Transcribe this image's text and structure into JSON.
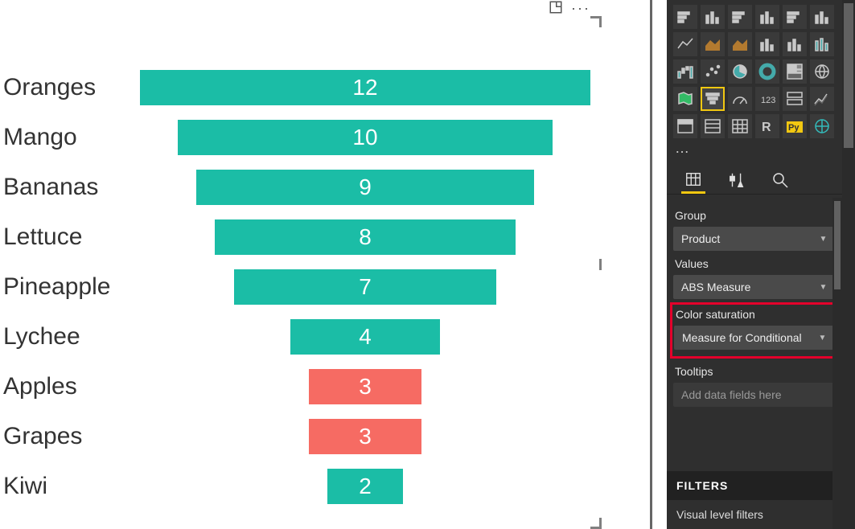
{
  "chart_data": {
    "type": "bar",
    "orientation": "funnel",
    "categories": [
      "Oranges",
      "Mango",
      "Bananas",
      "Lettuce",
      "Pineapple",
      "Lychee",
      "Apples",
      "Grapes",
      "Kiwi"
    ],
    "values": [
      12,
      10,
      9,
      8,
      7,
      4,
      3,
      3,
      2
    ],
    "colors": [
      "#1bbda6",
      "#1bbda6",
      "#1bbda6",
      "#1bbda6",
      "#1bbda6",
      "#1bbda6",
      "#f66b63",
      "#f66b63",
      "#1bbda6"
    ],
    "max_value": 12,
    "title": "",
    "xlabel": "",
    "ylabel": ""
  },
  "toolbar": {
    "focus_icon": "focus-mode-icon",
    "more_icon": "more-options-icon"
  },
  "viz_gallery": {
    "selected_index": 19,
    "icons": [
      "stacked-bar",
      "stacked-column",
      "clustered-bar",
      "clustered-column",
      "hundred-bar",
      "hundred-column",
      "line",
      "area",
      "stacked-area",
      "line-stacked-column",
      "line-clustered-column",
      "ribbon",
      "waterfall",
      "scatter",
      "pie",
      "donut",
      "treemap",
      "map",
      "filled-map",
      "funnel",
      "gauge",
      "card",
      "multi-card",
      "kpi",
      "slicer",
      "table",
      "matrix",
      "r-visual",
      "python-visual",
      "arcgis"
    ],
    "more": "…"
  },
  "tabs": {
    "fields": "fields-tab",
    "format": "format-tab",
    "analytics": "analytics-tab"
  },
  "wells": {
    "group": {
      "label": "Group",
      "value": "Product"
    },
    "values": {
      "label": "Values",
      "value": "ABS Measure"
    },
    "color_saturation": {
      "label": "Color saturation",
      "value": "Measure for Conditional"
    },
    "tooltips": {
      "label": "Tooltips",
      "placeholder": "Add data fields here"
    }
  },
  "filters": {
    "header": "FILTERS",
    "visual_level": "Visual level filters"
  }
}
